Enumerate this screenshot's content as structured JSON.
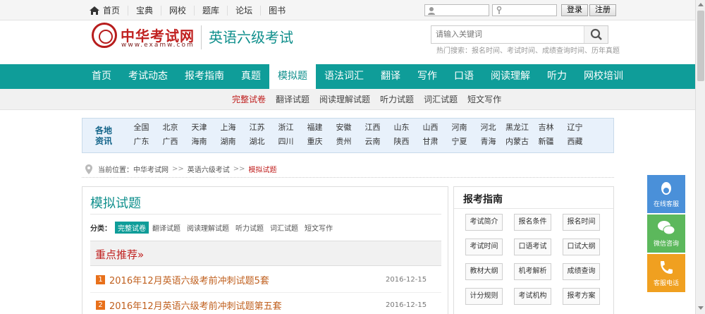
{
  "topnav": {
    "items": [
      "首页",
      "宝典",
      "网校",
      "题库",
      "论坛",
      "图书"
    ]
  },
  "login": {
    "login_button": "登录",
    "register_button": "注册"
  },
  "header": {
    "logo_text": "中华考试网",
    "logo_url": "www.examw.com",
    "site_title": "英语六级考试",
    "search_placeholder": "请输入关键词",
    "hot_words": "热门搜索：报名时间、考试时间、成绩查询时间、历年真题"
  },
  "mainnav": {
    "items": [
      "首页",
      "考试动态",
      "报考指南",
      "真题",
      "模拟题",
      "语法词汇",
      "翻译",
      "写作",
      "口语",
      "阅读理解",
      "听力",
      "网校培训"
    ],
    "active": "模拟题"
  },
  "subnav": {
    "items": [
      "完整试卷",
      "翻译试题",
      "阅读理解试题",
      "听力试题",
      "词汇试题",
      "短文写作"
    ],
    "active": "完整试卷"
  },
  "regions": {
    "label_line1": "各地",
    "label_line2": "资讯",
    "row1": [
      "全国",
      "北京",
      "天津",
      "上海",
      "江苏",
      "浙江",
      "福建",
      "安徽",
      "江西",
      "山东",
      "山西",
      "河南",
      "河北",
      "黑龙江",
      "吉林",
      "辽宁"
    ],
    "row2": [
      "广东",
      "广西",
      "海南",
      "湖南",
      "湖北",
      "四川",
      "重庆",
      "贵州",
      "云南",
      "陕西",
      "甘肃",
      "宁夏",
      "青海",
      "内蒙古",
      "新疆",
      "西藏"
    ]
  },
  "breadcrumb": {
    "prefix": "当前位置：",
    "items": [
      "中华考试网",
      "英语六级考试",
      "模拟试题"
    ],
    "separator": ">>"
  },
  "main": {
    "title": "模拟试题",
    "category_label": "分类：",
    "categories": [
      "完整试卷",
      "翻译试题",
      "阅读理解试题",
      "听力试题",
      "词汇试题",
      "短文写作"
    ],
    "featured_title": "重点推荐»",
    "articles": [
      {
        "num": "1",
        "title": "2016年12月英语六级考前冲刺试题5套",
        "date": "2016-12-15"
      },
      {
        "num": "2",
        "title": "2016年12月英语六级考前冲刺试题第五套",
        "date": "2016-12-15"
      }
    ]
  },
  "guide": {
    "title": "报考指南",
    "items": [
      "考试简介",
      "报名条件",
      "报名时间",
      "考试时间",
      "口语考试",
      "口试大纲",
      "教材大纲",
      "机考解析",
      "成绩查询",
      "计分规则",
      "考试机构",
      "报考方案"
    ]
  },
  "service": {
    "online": "在线客服",
    "wechat": "微信咨询",
    "phone": "客服电话"
  },
  "colors": {
    "accent": "#0f9d99",
    "brand_red": "#c0201f",
    "article_orange": "#e8701a"
  }
}
